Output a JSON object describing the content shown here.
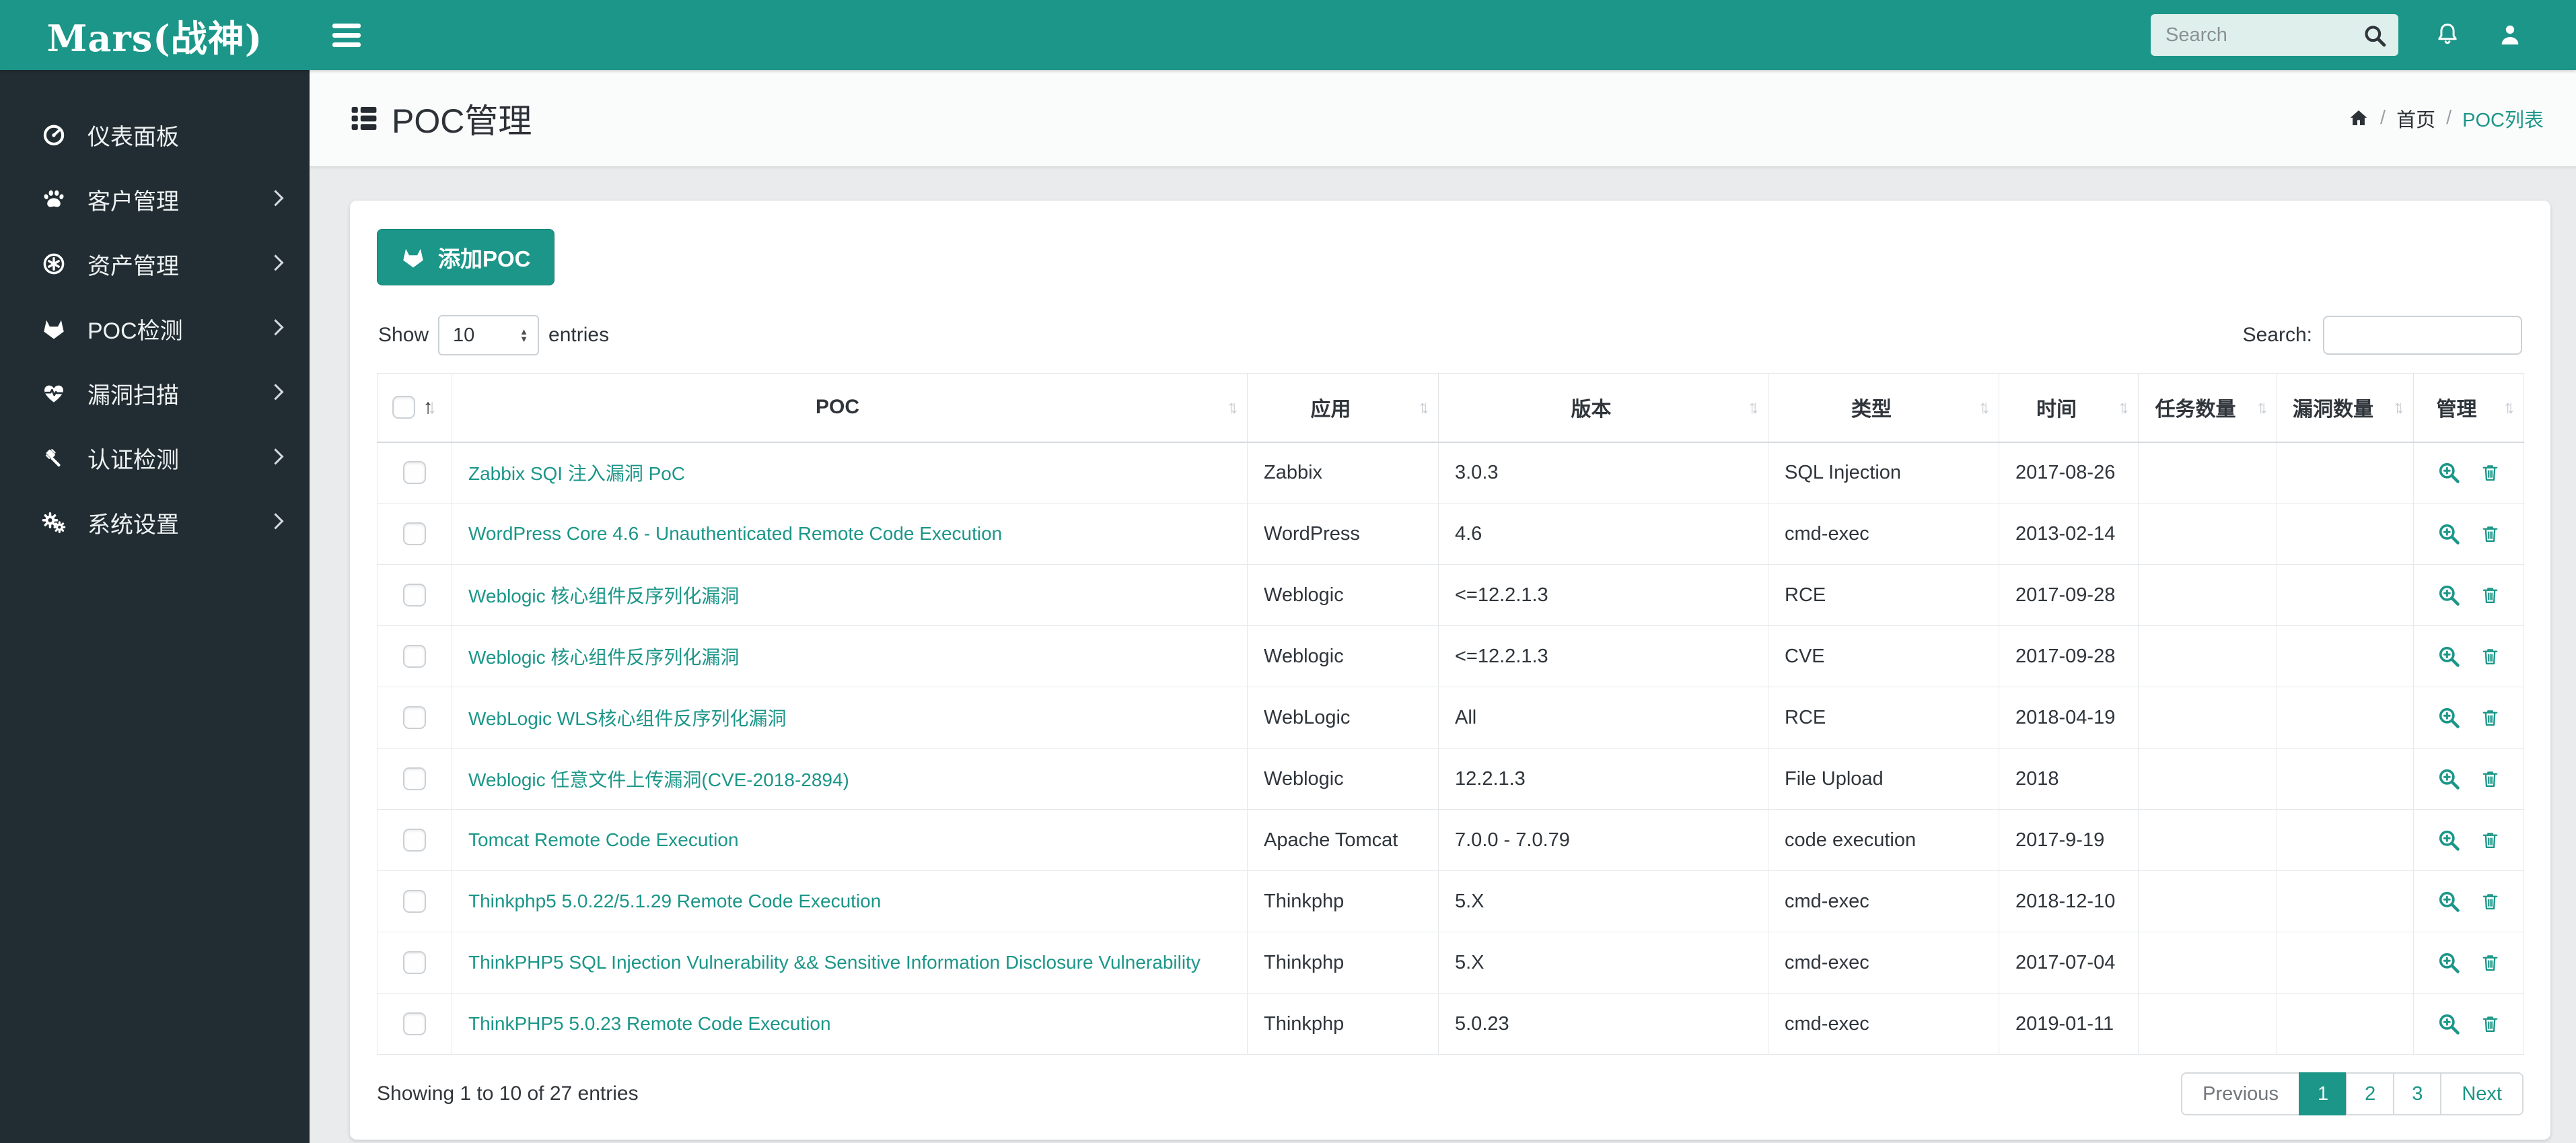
{
  "brand": {
    "logo": "Mars(战神)"
  },
  "topbar": {
    "search_placeholder": "Search",
    "icons": [
      "search-icon",
      "bell-icon",
      "user-icon"
    ]
  },
  "sidebar": {
    "items": [
      {
        "id": "dashboard",
        "label": "仪表面板",
        "icon": "tachometer-icon",
        "has_children": false
      },
      {
        "id": "customer-management",
        "label": "客户管理",
        "icon": "paw-icon",
        "has_children": true
      },
      {
        "id": "asset-management",
        "label": "资产管理",
        "icon": "asterisk-circle-icon",
        "has_children": true
      },
      {
        "id": "poc-detection",
        "label": "POC检测",
        "icon": "gitlab-fox-icon",
        "has_children": true
      },
      {
        "id": "vulnerability-scan",
        "label": "漏洞扫描",
        "icon": "heartbeat-icon",
        "has_children": true
      },
      {
        "id": "auth-detection",
        "label": "认证检测",
        "icon": "gavel-icon",
        "has_children": true
      },
      {
        "id": "system-settings",
        "label": "系统设置",
        "icon": "cogs-icon",
        "has_children": true
      }
    ]
  },
  "page": {
    "title": "POC管理",
    "title_icon": "th-list-icon",
    "breadcrumb": {
      "home_icon": "home-icon",
      "home": "首页",
      "separator": "/",
      "current": "POC列表"
    }
  },
  "toolbar": {
    "add_button": "添加POC",
    "add_button_icon": "gitlab-fox-icon",
    "show_label": "Show",
    "page_size": "10",
    "entries_label": "entries",
    "search_label": "Search:",
    "search_value": ""
  },
  "table": {
    "columns": [
      {
        "key": "poc",
        "label": "POC"
      },
      {
        "key": "app",
        "label": "应用"
      },
      {
        "key": "version",
        "label": "版本"
      },
      {
        "key": "type",
        "label": "类型"
      },
      {
        "key": "time",
        "label": "时间"
      },
      {
        "key": "task-count",
        "label": "任务数量"
      },
      {
        "key": "vuln-count",
        "label": "漏洞数量"
      },
      {
        "key": "manage",
        "label": "管理"
      }
    ],
    "row_actions": [
      {
        "name": "view",
        "icon": "search-plus-icon"
      },
      {
        "name": "delete",
        "icon": "trash-icon"
      }
    ],
    "rows": [
      {
        "poc": "Zabbix SQI 注入漏洞 PoC",
        "app": "Zabbix",
        "version": "3.0.3",
        "type": "SQL Injection",
        "time": "2017-08-26",
        "tasks": "",
        "vulns": ""
      },
      {
        "poc": "WordPress Core 4.6 - Unauthenticated Remote Code Execution",
        "app": "WordPress",
        "version": "4.6",
        "type": "cmd-exec",
        "time": "2013-02-14",
        "tasks": "",
        "vulns": ""
      },
      {
        "poc": "Weblogic 核心组件反序列化漏洞",
        "app": "Weblogic",
        "version": "<=12.2.1.3",
        "type": "RCE",
        "time": "2017-09-28",
        "tasks": "",
        "vulns": ""
      },
      {
        "poc": "Weblogic 核心组件反序列化漏洞",
        "app": "Weblogic",
        "version": "<=12.2.1.3",
        "type": "CVE",
        "time": "2017-09-28",
        "tasks": "",
        "vulns": ""
      },
      {
        "poc": "WebLogic WLS核心组件反序列化漏洞",
        "app": "WebLogic",
        "version": "All",
        "type": "RCE",
        "time": "2018-04-19",
        "tasks": "",
        "vulns": ""
      },
      {
        "poc": "Weblogic 任意文件上传漏洞(CVE-2018-2894)",
        "app": "Weblogic",
        "version": "12.2.1.3",
        "type": "File Upload",
        "time": "2018",
        "tasks": "",
        "vulns": ""
      },
      {
        "poc": "Tomcat Remote Code Execution",
        "app": "Apache Tomcat",
        "version": "7.0.0 - 7.0.79",
        "type": "code execution",
        "time": "2017-9-19",
        "tasks": "",
        "vulns": ""
      },
      {
        "poc": "Thinkphp5 5.0.22/5.1.29 Remote Code Execution",
        "app": "Thinkphp",
        "version": "5.X",
        "type": "cmd-exec",
        "time": "2018-12-10",
        "tasks": "",
        "vulns": ""
      },
      {
        "poc": "ThinkPHP5 SQL Injection Vulnerability && Sensitive Information Disclosure Vulnerability",
        "app": "Thinkphp",
        "version": "5.X",
        "type": "cmd-exec",
        "time": "2017-07-04",
        "tasks": "",
        "vulns": ""
      },
      {
        "poc": "ThinkPHP5 5.0.23 Remote Code Execution",
        "app": "Thinkphp",
        "version": "5.0.23",
        "type": "cmd-exec",
        "time": "2019-01-11",
        "tasks": "",
        "vulns": ""
      }
    ]
  },
  "footer": {
    "info": "Showing 1 to 10 of 27 entries",
    "pagination": {
      "previous": "Previous",
      "pages": [
        "1",
        "2",
        "3"
      ],
      "active_page": "1",
      "next": "Next"
    }
  },
  "colors": {
    "primary_teal": "#1B9688",
    "sidebar_bg": "#222D33",
    "link_teal": "#1B9688",
    "content_bg": "#E9EBEC",
    "pagination_active_bg": "#1B9688"
  }
}
